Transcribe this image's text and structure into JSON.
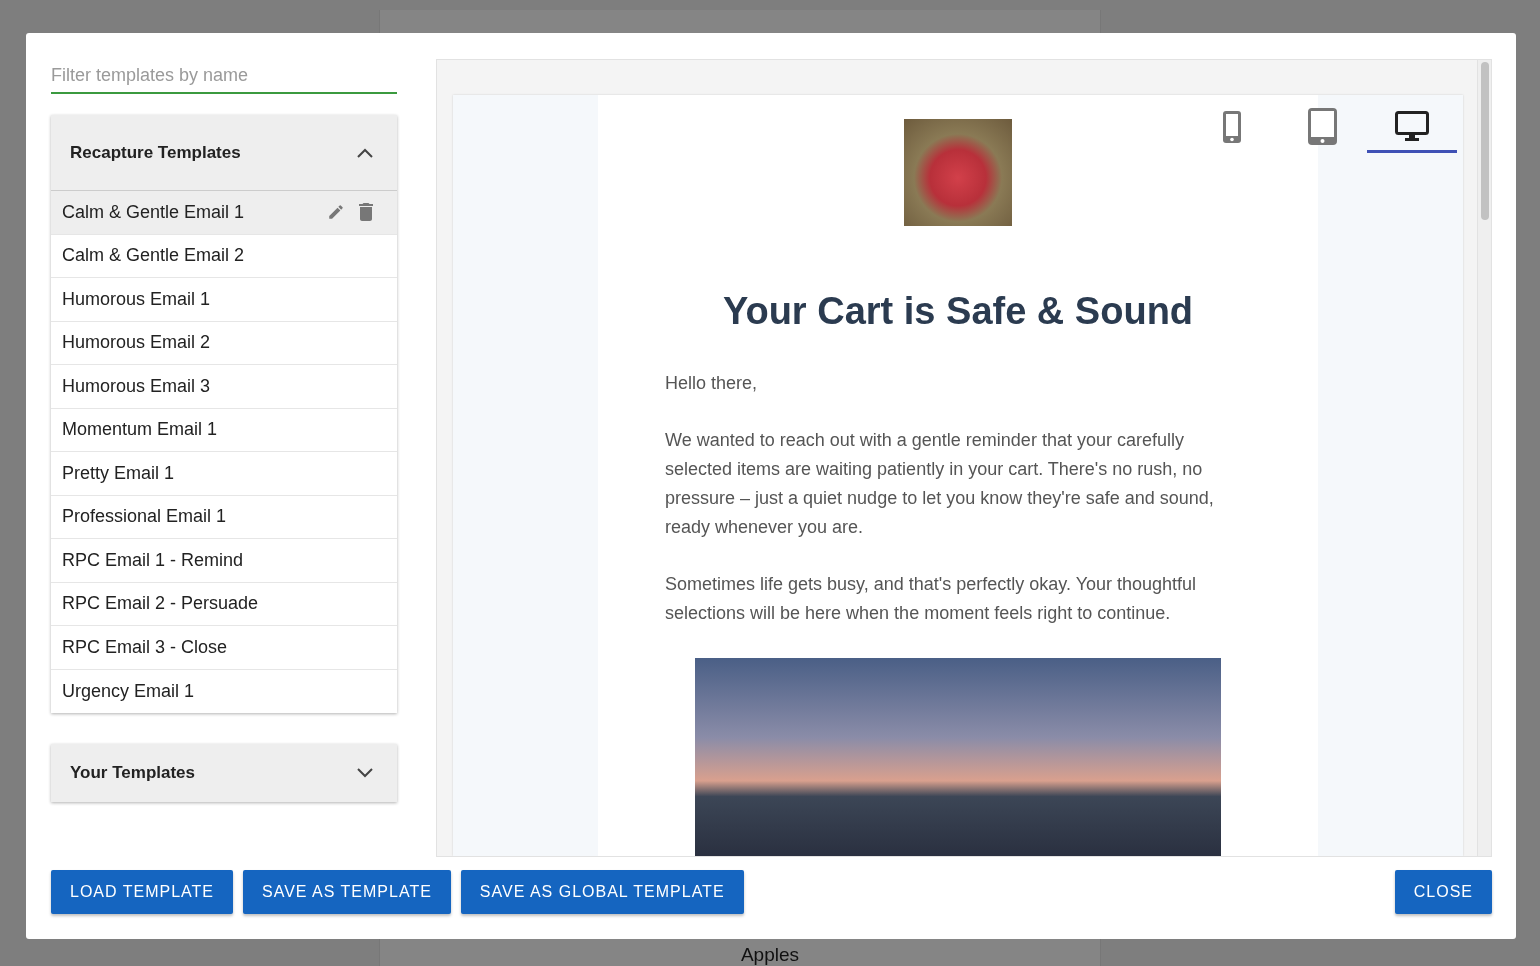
{
  "background": {
    "text": "Apples"
  },
  "filter": {
    "placeholder": "Filter templates by name"
  },
  "sections": [
    {
      "title": "Recapture Templates",
      "expanded": true,
      "items": [
        {
          "name": "Calm & Gentle Email 1",
          "selected": true
        },
        {
          "name": "Calm & Gentle Email 2",
          "selected": false
        },
        {
          "name": "Humorous Email 1",
          "selected": false
        },
        {
          "name": "Humorous Email 2",
          "selected": false
        },
        {
          "name": "Humorous Email 3",
          "selected": false
        },
        {
          "name": "Momentum Email 1",
          "selected": false
        },
        {
          "name": "Pretty Email 1",
          "selected": false
        },
        {
          "name": "Professional Email 1",
          "selected": false
        },
        {
          "name": "RPC Email 1 - Remind",
          "selected": false
        },
        {
          "name": "RPC Email 2 - Persuade",
          "selected": false
        },
        {
          "name": "RPC Email 3 - Close",
          "selected": false
        },
        {
          "name": "Urgency Email 1",
          "selected": false
        }
      ]
    },
    {
      "title": "Your Templates",
      "expanded": false
    }
  ],
  "devices": [
    {
      "kind": "phone",
      "selected": false
    },
    {
      "kind": "tablet",
      "selected": false
    },
    {
      "kind": "desktop",
      "selected": true
    }
  ],
  "email": {
    "heading": "Your Cart is Safe & Sound",
    "paragraphs": [
      "Hello there,",
      "We wanted to reach out with a gentle reminder that your carefully selected items are waiting patiently in your cart. There's no rush, no pressure – just a quiet nudge to let you know they're safe and sound, ready whenever you are.",
      "Sometimes life gets busy, and that's perfectly okay. Your thoughtful selections will be here when the moment feels right to continue."
    ]
  },
  "actions": [
    "LOAD TEMPLATE",
    "SAVE AS TEMPLATE",
    "SAVE AS GLOBAL TEMPLATE"
  ],
  "close": "CLOSE"
}
